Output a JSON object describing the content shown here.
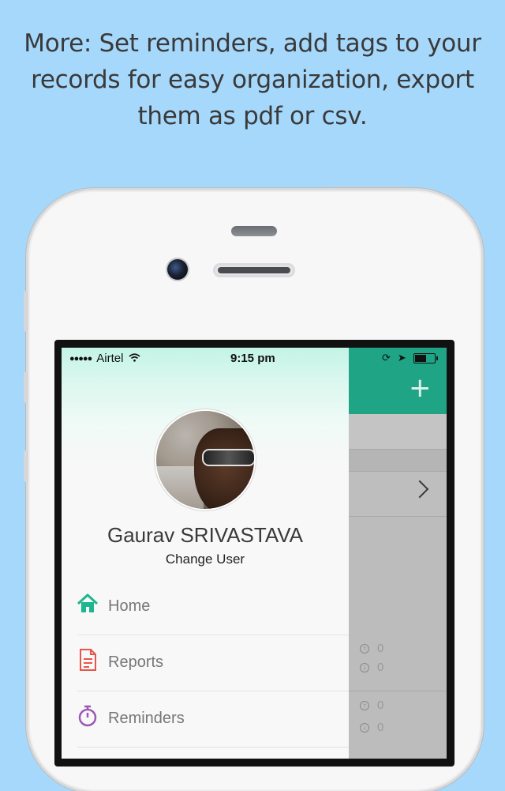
{
  "headline": "More: Set reminders, add tags to your records for easy organization, export them as pdf or csv.",
  "status_bar": {
    "carrier": "Airtel",
    "time": "9:15 pm"
  },
  "profile": {
    "name": "Gaurav SRIVASTAVA",
    "change_user": "Change User"
  },
  "menu": [
    {
      "label": "Home",
      "icon": "home-icon",
      "color": "#1fb58f"
    },
    {
      "label": "Reports",
      "icon": "document-icon",
      "color": "#e8564a"
    },
    {
      "label": "Reminders",
      "icon": "stopwatch-icon",
      "color": "#9b59b6"
    }
  ],
  "background_app": {
    "add_label": "+",
    "stats": [
      "0",
      "0",
      "0",
      "0"
    ],
    "accent": "#1fa585"
  }
}
